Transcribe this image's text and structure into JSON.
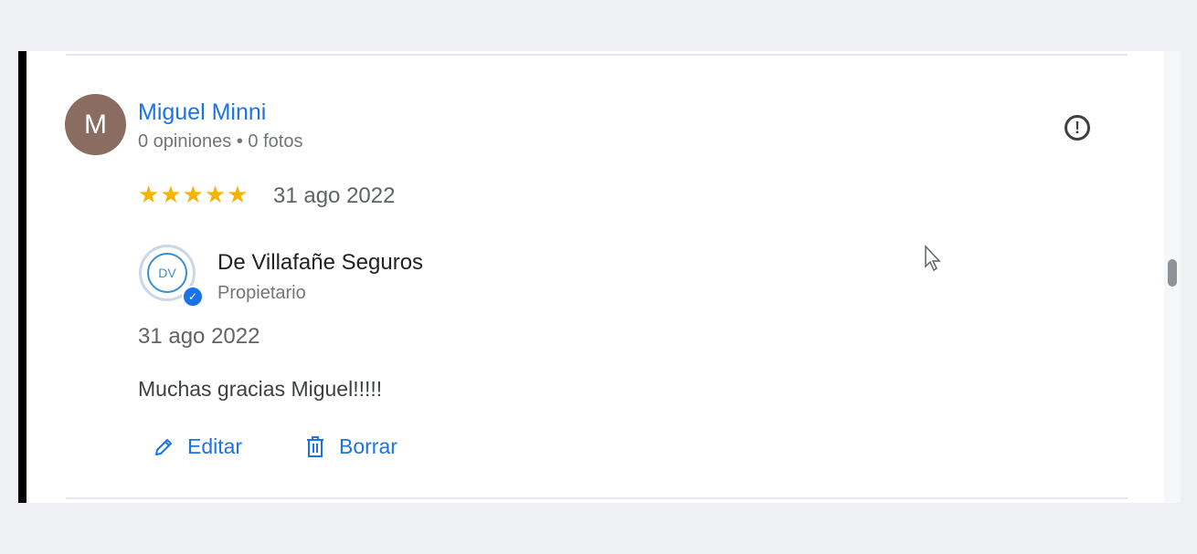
{
  "review": {
    "avatar_letter": "M",
    "reviewer_name": "Miguel Minni",
    "reviewer_meta": "0 opiniones • 0 fotos",
    "rating": 5,
    "stars": "★★★★★",
    "date": "31 ago 2022",
    "report_icon": "report-icon"
  },
  "owner_reply": {
    "logo_text": "DV",
    "owner_name": "De Villafañe Seguros",
    "role": "Propietario",
    "date": "31 ago 2022",
    "text": "Muchas gracias Miguel!!!!!"
  },
  "actions": {
    "edit_label": "Editar",
    "delete_label": "Borrar"
  },
  "colors": {
    "link": "#1a73e8",
    "star": "#f4b400",
    "avatar": "#8a6c61",
    "page_background": "#eef0f4"
  }
}
